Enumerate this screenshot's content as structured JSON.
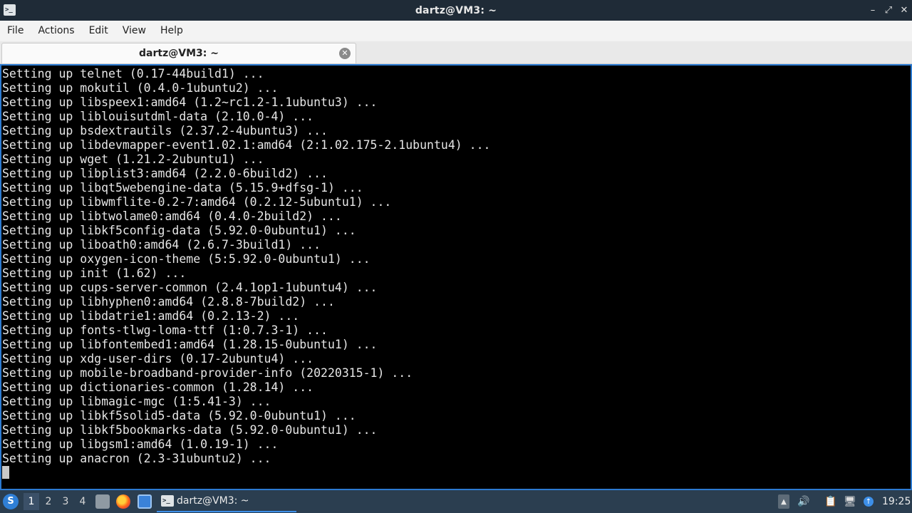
{
  "window": {
    "app_icon": "terminal-icon",
    "app_icon_glyph": ">_",
    "title": "dartz@VM3: ~",
    "controls": {
      "minimize": "–",
      "maximize": "⤢",
      "close": "✕"
    }
  },
  "menu": {
    "items": [
      "File",
      "Actions",
      "Edit",
      "View",
      "Help"
    ]
  },
  "tabs": [
    {
      "label": "dartz@VM3: ~",
      "close_icon": "close-icon",
      "close_glyph": "✕"
    }
  ],
  "terminal": {
    "lines": [
      "Setting up telnet (0.17-44build1) ...",
      "Setting up mokutil (0.4.0-1ubuntu2) ...",
      "Setting up libspeex1:amd64 (1.2~rc1.2-1.1ubuntu3) ...",
      "Setting up liblouisutdml-data (2.10.0-4) ...",
      "Setting up bsdextrautils (2.37.2-4ubuntu3) ...",
      "Setting up libdevmapper-event1.02.1:amd64 (2:1.02.175-2.1ubuntu4) ...",
      "Setting up wget (1.21.2-2ubuntu1) ...",
      "Setting up libplist3:amd64 (2.2.0-6build2) ...",
      "Setting up libqt5webengine-data (5.15.9+dfsg-1) ...",
      "Setting up libwmflite-0.2-7:amd64 (0.2.12-5ubuntu1) ...",
      "Setting up libtwolame0:amd64 (0.4.0-2build2) ...",
      "Setting up libkf5config-data (5.92.0-0ubuntu1) ...",
      "Setting up liboath0:amd64 (2.6.7-3build1) ...",
      "Setting up oxygen-icon-theme (5:5.92.0-0ubuntu1) ...",
      "Setting up init (1.62) ...",
      "Setting up cups-server-common (2.4.1op1-1ubuntu4) ...",
      "Setting up libhyphen0:amd64 (2.8.8-7build2) ...",
      "Setting up libdatrie1:amd64 (0.2.13-2) ...",
      "Setting up fonts-tlwg-loma-ttf (1:0.7.3-1) ...",
      "Setting up libfontembed1:amd64 (1.28.15-0ubuntu1) ...",
      "Setting up xdg-user-dirs (0.17-2ubuntu4) ...",
      "Setting up mobile-broadband-provider-info (20220315-1) ...",
      "Setting up dictionaries-common (1.28.14) ...",
      "Setting up libmagic-mgc (1:5.41-3) ...",
      "Setting up libkf5solid5-data (5.92.0-0ubuntu1) ...",
      "Setting up libkf5bookmarks-data (5.92.0-0ubuntu1) ...",
      "Setting up libgsm1:amd64 (1.0.19-1) ...",
      "Setting up anacron (2.3-31ubuntu2) ..."
    ]
  },
  "taskbar": {
    "start_icon": "start-menu-icon",
    "start_glyph": "S",
    "workspaces": [
      "1",
      "2",
      "3",
      "4"
    ],
    "active_workspace": "1",
    "launchers": [
      "files-icon",
      "firefox-icon",
      "show-desktop-icon"
    ],
    "task": {
      "label": "dartz@VM3: ~",
      "icon": "terminal-icon",
      "icon_glyph": ">_"
    },
    "tray": {
      "expand_glyph": "▲",
      "volume_glyph": "🔊",
      "clipboard_glyph": "📋",
      "network_glyph": "🖥",
      "updates_glyph": "↑"
    },
    "clock": "19:25"
  }
}
